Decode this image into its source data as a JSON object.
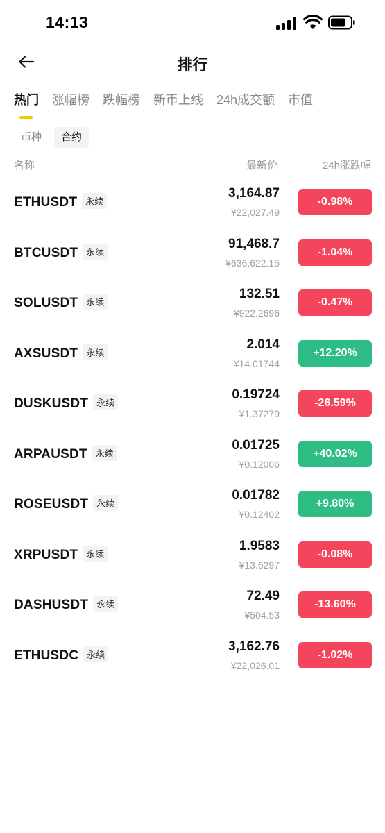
{
  "status_bar": {
    "time": "14:13"
  },
  "header": {
    "title": "排行"
  },
  "tabs": [
    {
      "label": "热门",
      "active": true
    },
    {
      "label": "涨幅榜",
      "active": false
    },
    {
      "label": "跌幅榜",
      "active": false
    },
    {
      "label": "新币上线",
      "active": false
    },
    {
      "label": "24h成交额",
      "active": false
    },
    {
      "label": "市值",
      "active": false
    }
  ],
  "subtabs": [
    {
      "label": "币种",
      "active": false
    },
    {
      "label": "合约",
      "active": true
    }
  ],
  "columns": {
    "name": "名称",
    "price": "最新价",
    "change": "24h涨跌幅"
  },
  "badge_label": "永续",
  "colors": {
    "down": "#f5455c",
    "up": "#2ebd85",
    "accent": "#f7c600"
  },
  "rows": [
    {
      "pair": "ETHUSDT",
      "badge": "永续",
      "price": "3,164.87",
      "cny": "¥22,027.49",
      "change": "-0.98%",
      "direction": "down"
    },
    {
      "pair": "BTCUSDT",
      "badge": "永续",
      "price": "91,468.7",
      "cny": "¥636,622.15",
      "change": "-1.04%",
      "direction": "down"
    },
    {
      "pair": "SOLUSDT",
      "badge": "永续",
      "price": "132.51",
      "cny": "¥922.2696",
      "change": "-0.47%",
      "direction": "down"
    },
    {
      "pair": "AXSUSDT",
      "badge": "永续",
      "price": "2.014",
      "cny": "¥14.01744",
      "change": "+12.20%",
      "direction": "up"
    },
    {
      "pair": "DUSKUSDT",
      "badge": "永续",
      "price": "0.19724",
      "cny": "¥1.37279",
      "change": "-26.59%",
      "direction": "down"
    },
    {
      "pair": "ARPAUSDT",
      "badge": "永续",
      "price": "0.01725",
      "cny": "¥0.12006",
      "change": "+40.02%",
      "direction": "up"
    },
    {
      "pair": "ROSEUSDT",
      "badge": "永续",
      "price": "0.01782",
      "cny": "¥0.12402",
      "change": "+9.80%",
      "direction": "up"
    },
    {
      "pair": "XRPUSDT",
      "badge": "永续",
      "price": "1.9583",
      "cny": "¥13.6297",
      "change": "-0.08%",
      "direction": "down"
    },
    {
      "pair": "DASHUSDT",
      "badge": "永续",
      "price": "72.49",
      "cny": "¥504.53",
      "change": "-13.60%",
      "direction": "down"
    },
    {
      "pair": "ETHUSDC",
      "badge": "永续",
      "price": "3,162.76",
      "cny": "¥22,026.01",
      "change": "-1.02%",
      "direction": "down"
    }
  ]
}
